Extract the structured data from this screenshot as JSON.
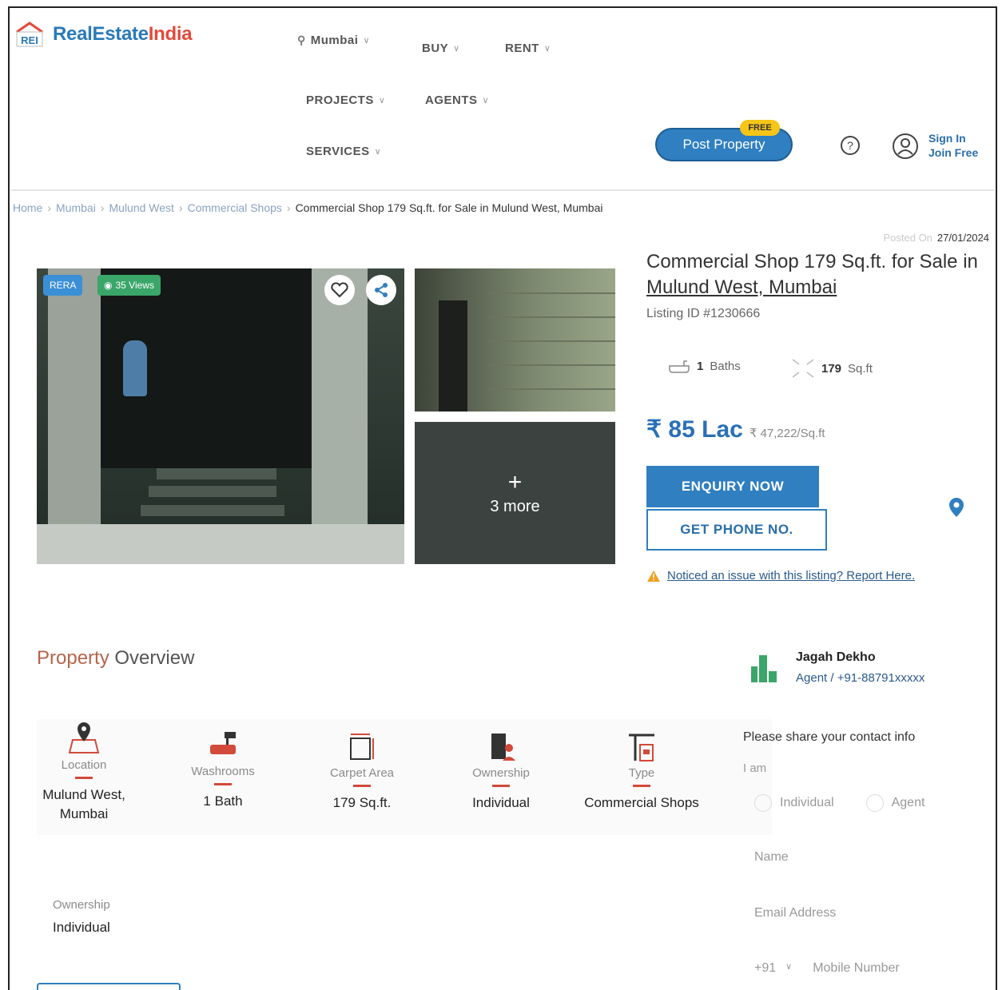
{
  "header": {
    "brand_prefix": "RealEstate",
    "brand_suffix": "India",
    "logo_mark": "REI",
    "city": "Mumbai",
    "nav": {
      "buy": "BUY",
      "rent": "RENT",
      "projects": "PROJECTS",
      "agents": "AGENTS",
      "services": "SERVICES"
    },
    "post_property": "Post Property",
    "free_badge": "FREE",
    "help_icon": "help-icon",
    "sign_in": "Sign In",
    "join_free": "Join Free"
  },
  "breadcrumb": [
    "Home",
    "Mumbai",
    "Mulund West",
    "Commercial Shops",
    "Commercial Shop 179 Sq.ft. for Sale in Mulund West, Mumbai"
  ],
  "posted": {
    "label": "Posted On",
    "date": "27/01/2024"
  },
  "gallery": {
    "rera_badge": "RERA",
    "views": "35 Views",
    "more_label": "3 more",
    "plus": "+"
  },
  "listing": {
    "title_prefix": "Commercial Shop 179 Sq.ft. for Sale in ",
    "title_location": "Mulund West, Mumbai",
    "listing_id": "Listing ID #1230666",
    "baths_count": "1",
    "baths_label": "Baths",
    "area_value": "179",
    "area_unit": "Sq.ft",
    "price": "₹ 85 Lac",
    "price_per_sqft": "₹ 47,222/Sq.ft",
    "enquiry_button": "ENQUIRY NOW",
    "phone_button": "GET PHONE NO.",
    "report_text": "Noticed an issue with this listing? Report Here."
  },
  "overview": {
    "title_part1": "Property ",
    "title_part2": "Overview",
    "items": [
      {
        "label": "Location",
        "value": "Mulund West, Mumbai",
        "icon": "location-icon"
      },
      {
        "label": "Washrooms",
        "value": "1 Bath",
        "icon": "bathtub-icon"
      },
      {
        "label": "Carpet Area",
        "value": "179 Sq.ft.",
        "icon": "area-icon"
      },
      {
        "label": "Ownership",
        "value": "Individual",
        "icon": "building-icon"
      },
      {
        "label": "Type",
        "value": "Commercial Shops",
        "icon": "crane-icon"
      }
    ],
    "extra_label": "Ownership",
    "extra_value": "Individual"
  },
  "agent": {
    "name": "Jagah Dekho",
    "subtitle": "Agent / +91-88791xxxxx",
    "form_title": "Please share your contact info",
    "i_am": "I am",
    "option_individual": "Individual",
    "option_agent": "Agent",
    "name_placeholder": "Name",
    "email_placeholder": "Email Address",
    "country_code": "+91",
    "mobile_placeholder": "Mobile Number"
  },
  "colors": {
    "brand_blue": "#2f7fc1",
    "brand_red": "#e24a3b",
    "free_yellow": "#f5c518"
  }
}
